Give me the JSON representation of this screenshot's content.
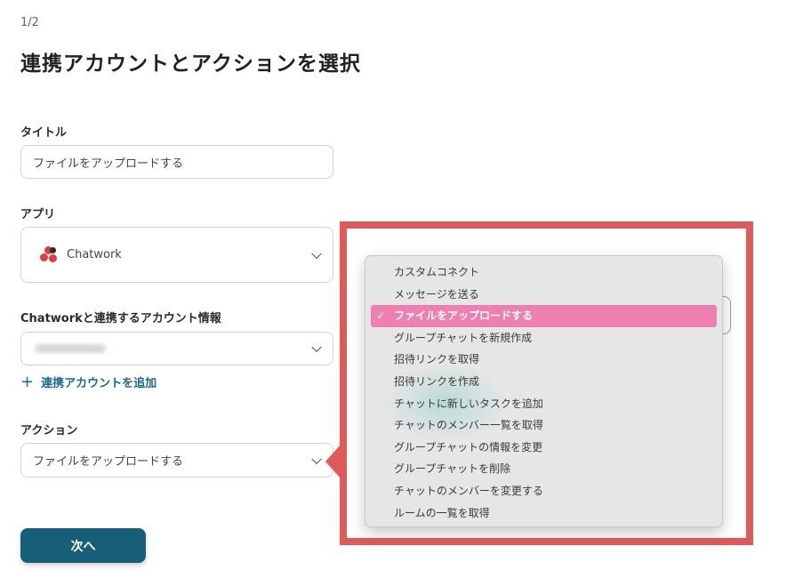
{
  "header": {
    "step": "1/2",
    "title": "連携アカウントとアクションを選択"
  },
  "form": {
    "title_label": "タイトル",
    "title_value": "ファイルをアップロードする",
    "app_label": "アプリ",
    "app_value": "Chatwork",
    "account_label": "Chatworkと連携するアカウント情報",
    "add_account_link": "連携アカウントを追加",
    "action_label": "アクション",
    "action_value": "ファイルをアップロードする",
    "next_button": "次へ"
  },
  "dropdown": {
    "items": [
      {
        "label": "カスタムコネクト",
        "selected": false
      },
      {
        "label": "メッセージを送る",
        "selected": false
      },
      {
        "label": "ファイルをアップロードする",
        "selected": true
      },
      {
        "label": "グループチャットを新規作成",
        "selected": false
      },
      {
        "label": "招待リンクを取得",
        "selected": false
      },
      {
        "label": "招待リンクを作成",
        "selected": false
      },
      {
        "label": "チャットに新しいタスクを追加",
        "selected": false
      },
      {
        "label": "チャットのメンバー一覧を取得",
        "selected": false
      },
      {
        "label": "グループチャットの情報を変更",
        "selected": false
      },
      {
        "label": "グループチャットを削除",
        "selected": false
      },
      {
        "label": "チャットのメンバーを変更する",
        "selected": false
      },
      {
        "label": "ルームの一覧を取得",
        "selected": false
      }
    ],
    "check_glyph": "✓"
  },
  "colors": {
    "primary": "#175e78",
    "highlight": "#e05a5a",
    "selected_item": "#ef7fb0",
    "link": "#1b6a8c"
  },
  "icons": {
    "app_logo": "chatwork-logo-icon",
    "select_arrow": "chevron-down-icon",
    "add": "plus-icon"
  }
}
